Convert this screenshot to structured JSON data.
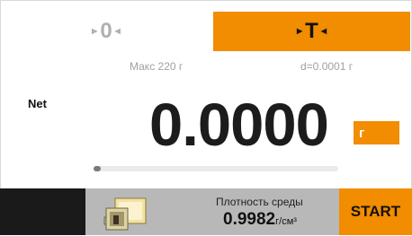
{
  "zero_button": {
    "label": "0"
  },
  "tare_button": {
    "label": "T"
  },
  "range": {
    "max": "Макс 220 г",
    "readability": "d=0.0001 г"
  },
  "mode_label": "Net",
  "weight": {
    "value": "0.0000",
    "unit": "г"
  },
  "capacity_bar": {
    "fraction": 0.03
  },
  "density": {
    "label": "Плотность среды",
    "value": "0.9982",
    "unit": "г/см³"
  },
  "start_button": {
    "label": "START"
  },
  "colors": {
    "accent": "#f28c00",
    "dark": "#1a1a1a",
    "panel": "#b8b8b8"
  },
  "icons": {
    "app": "density-kit-icon"
  }
}
